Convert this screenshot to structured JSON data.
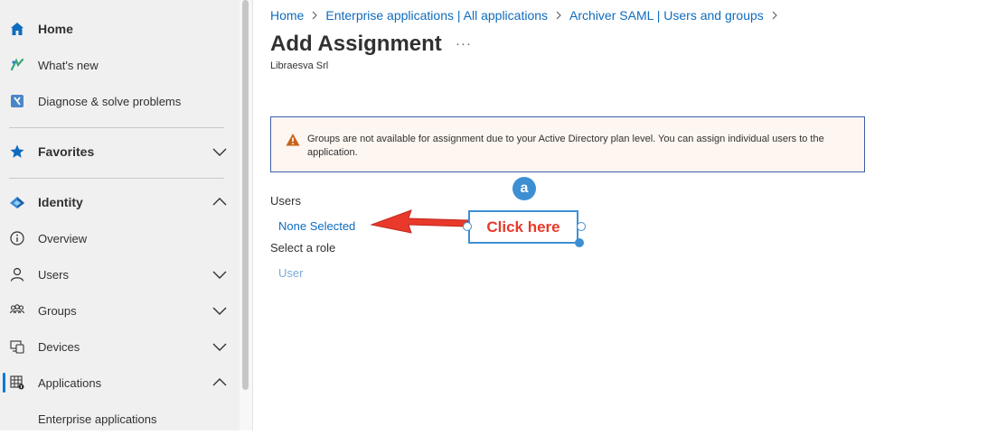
{
  "sidebar": {
    "items": [
      {
        "label": "Home",
        "icon": "home-icon"
      },
      {
        "label": "What's new",
        "icon": "whats-new-icon"
      },
      {
        "label": "Diagnose & solve problems",
        "icon": "diagnose-icon"
      },
      {
        "label": "Favorites",
        "icon": "star-icon"
      },
      {
        "label": "Identity",
        "icon": "identity-icon"
      },
      {
        "label": "Overview",
        "icon": "info-icon"
      },
      {
        "label": "Users",
        "icon": "user-icon"
      },
      {
        "label": "Groups",
        "icon": "groups-icon"
      },
      {
        "label": "Devices",
        "icon": "devices-icon"
      },
      {
        "label": "Applications",
        "icon": "applications-icon"
      },
      {
        "label": "Enterprise applications"
      }
    ]
  },
  "breadcrumb": [
    "Home",
    "Enterprise applications | All applications",
    "Archiver SAML | Users and groups"
  ],
  "page": {
    "title": "Add Assignment",
    "more": "···",
    "subtitle": "Libraesva Srl"
  },
  "warning": {
    "text": "Groups are not available for assignment due to your Active Directory plan level. You can assign individual users to the application."
  },
  "form": {
    "users_label": "Users",
    "users_value": "None Selected",
    "role_label": "Select a role",
    "role_value": "User"
  },
  "callout": {
    "badge": "a",
    "text": "Click here"
  },
  "colors": {
    "accent": "#0078d4",
    "link": "#0f6cbd",
    "warning_icon": "#c8631c",
    "annotation_arrow": "#e8392b",
    "annotation_frame": "#3d8fd4"
  }
}
